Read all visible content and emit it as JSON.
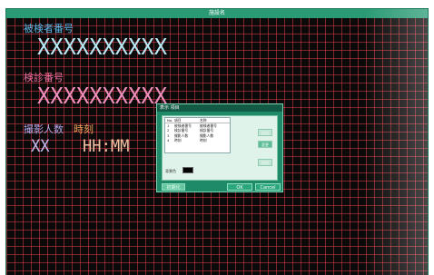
{
  "window": {
    "title": "施設名"
  },
  "patient": {
    "label": "被検者番号",
    "value": "XXXXXXXXXX"
  },
  "exam": {
    "label": "検診番号",
    "value": "XXXXXXXXXX"
  },
  "shots": {
    "label": "撮影人数",
    "value": "XX"
  },
  "time": {
    "label": "時刻",
    "value": "HH:MM"
  },
  "dialog": {
    "title": "表示 項目",
    "list": {
      "headers": [
        "No.",
        "項目",
        "名称"
      ],
      "rows": [
        [
          "1",
          "被検者番号",
          "被検者番号"
        ],
        [
          "2",
          "検診番号",
          "検診番号"
        ],
        [
          "3",
          "撮影人数",
          "撮影人数"
        ],
        [
          "4",
          "時刻",
          "時刻"
        ]
      ]
    },
    "side_buttons": [
      "追加",
      "変更",
      "削除"
    ],
    "background_label": "背景色",
    "init_label": "初期化",
    "ok_label": "OK",
    "cancel_label": "Cancel"
  },
  "colors": {
    "grid_line": "#dc3c46",
    "background": "#0a0a0a",
    "titlebar": "#2a9a74"
  }
}
